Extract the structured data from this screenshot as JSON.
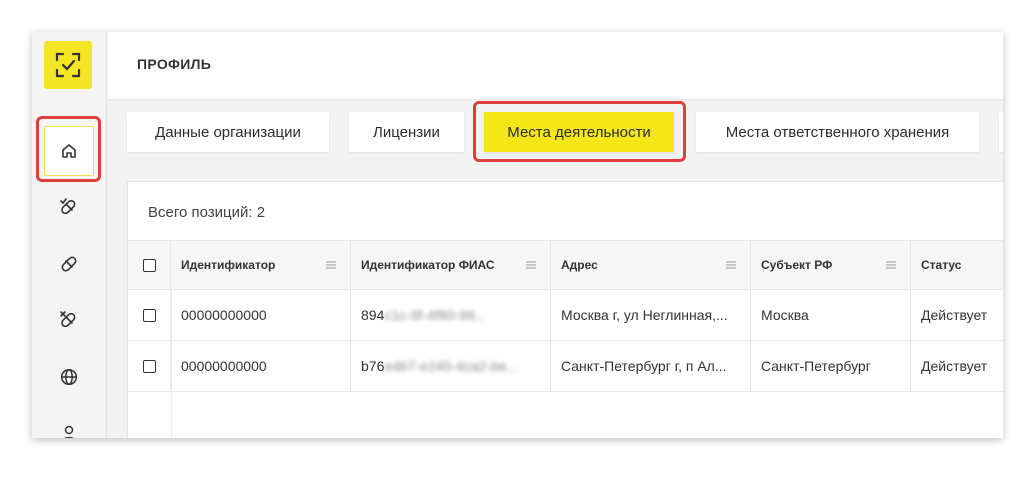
{
  "header": {
    "title": "ПРОФИЛЬ"
  },
  "tabs": [
    {
      "label": "Данные организации",
      "active": false
    },
    {
      "label": "Лицензии",
      "active": false
    },
    {
      "label": "Места деятельности",
      "active": true
    },
    {
      "label": "Места ответственного хранения",
      "active": false
    }
  ],
  "sidebar": {
    "items": [
      {
        "icon": "home-icon",
        "active": true
      },
      {
        "icon": "pill-check-icon",
        "active": false
      },
      {
        "icon": "pill-icon",
        "active": false
      },
      {
        "icon": "pill-cancel-icon",
        "active": false
      },
      {
        "icon": "globe-icon",
        "active": false
      },
      {
        "icon": "user-icon",
        "active": false
      }
    ]
  },
  "table": {
    "total_label": "Всего позиций: 2",
    "columns": [
      "Идентификатор",
      "Идентификатор ФИАС",
      "Адрес",
      "Субъект РФ",
      "Статус"
    ],
    "rows": [
      {
        "id": "00000000000",
        "fias_prefix": "894",
        "fias_rest": "...",
        "address": "Москва г, ул Неглинная,...",
        "region": "Москва",
        "status": "Действует"
      },
      {
        "id": "00000000000",
        "fias_prefix": "b76",
        "fias_rest": "...",
        "address": "Санкт-Петербург г, п Ал...",
        "region": "Санкт-Петербург",
        "status": "Действует"
      }
    ]
  },
  "colors": {
    "accent": "#f5e618",
    "highlight": "#de3e3c"
  }
}
